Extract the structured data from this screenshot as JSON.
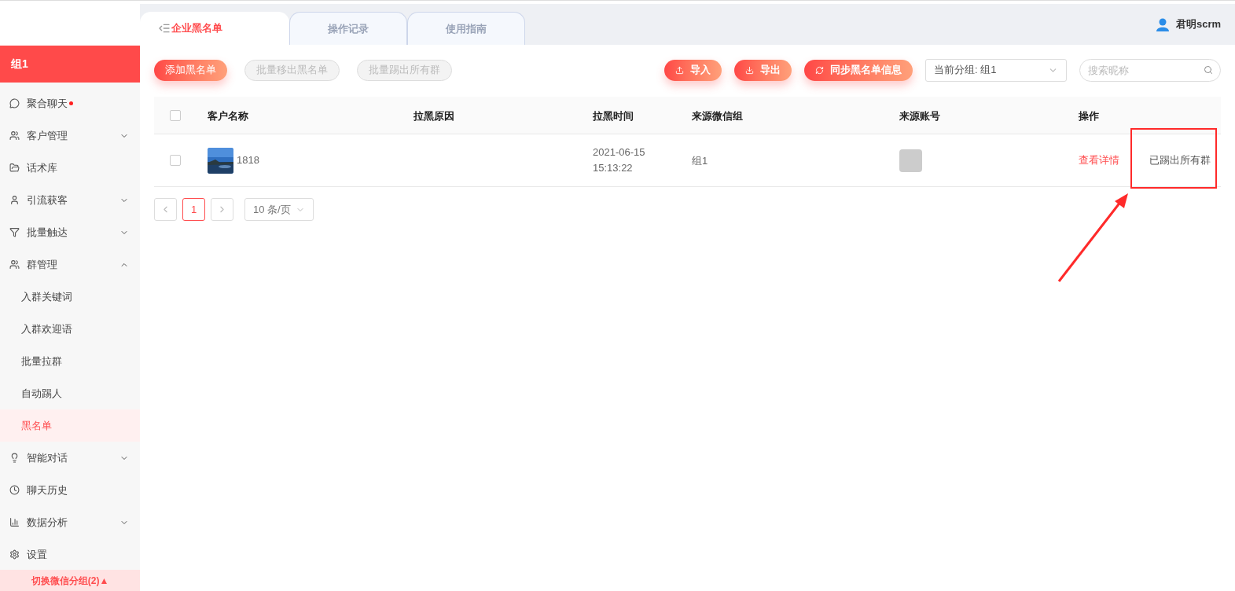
{
  "header": {
    "user": "君明scrm"
  },
  "tabs": [
    {
      "label": "企业黑名单",
      "selected": true
    },
    {
      "label": "操作记录",
      "selected": false
    },
    {
      "label": "使用指南",
      "selected": false
    }
  ],
  "sidebar": {
    "group": "组1",
    "items": [
      {
        "label": "聚合聊天",
        "dot": true,
        "selected": false
      },
      {
        "label": "客户管理",
        "expanded": false,
        "selected": false
      },
      {
        "label": "话术库",
        "selected": false
      },
      {
        "label": "引流获客",
        "expanded": false,
        "selected": false
      },
      {
        "label": "批量触达",
        "expanded": false,
        "selected": false
      },
      {
        "label": "群管理",
        "expanded": true,
        "selected": false,
        "children": [
          {
            "label": "入群关键词",
            "selected": false
          },
          {
            "label": "入群欢迎语",
            "selected": false
          },
          {
            "label": "批量拉群",
            "selected": false
          },
          {
            "label": "自动踢人",
            "selected": false
          },
          {
            "label": "黑名单",
            "selected": true
          }
        ]
      },
      {
        "label": "智能对话",
        "expanded": false,
        "selected": false
      },
      {
        "label": "聊天历史",
        "selected": false
      },
      {
        "label": "数据分析",
        "expanded": false,
        "selected": false
      },
      {
        "label": "设置",
        "selected": false
      }
    ],
    "footer": "切换微信分组(2)▲"
  },
  "toolbar": {
    "left": [
      {
        "label": "添加黑名单",
        "disabled": false
      },
      {
        "label": "批量移出黑名单",
        "disabled": true
      },
      {
        "label": "批量踢出所有群",
        "disabled": true
      }
    ],
    "right": [
      {
        "label": "导入",
        "kind": "upload"
      },
      {
        "label": "导出",
        "kind": "download"
      },
      {
        "label": "同步黑名单信息",
        "kind": "sync"
      }
    ],
    "group_select": "当前分组: 组1",
    "search": {
      "placeholder": "搜索昵称"
    }
  },
  "table": {
    "all_checked": false,
    "columns": [
      "客户名称",
      "拉黑原因",
      "拉黑时间",
      "来源微信组",
      "来源账号",
      "操作"
    ],
    "rows": [
      {
        "checked": false,
        "name": "1818",
        "time": [
          "2021-06-15",
          "15:13:22"
        ],
        "group": "组1",
        "actions": [
          {
            "label": "查看详情",
            "kind": "link"
          },
          {
            "label": "已踢出所有群",
            "kind": "status"
          }
        ]
      }
    ]
  },
  "pagination": {
    "pages": [
      {
        "label": "1",
        "selected": true
      }
    ],
    "page_size": "10 条/页"
  }
}
